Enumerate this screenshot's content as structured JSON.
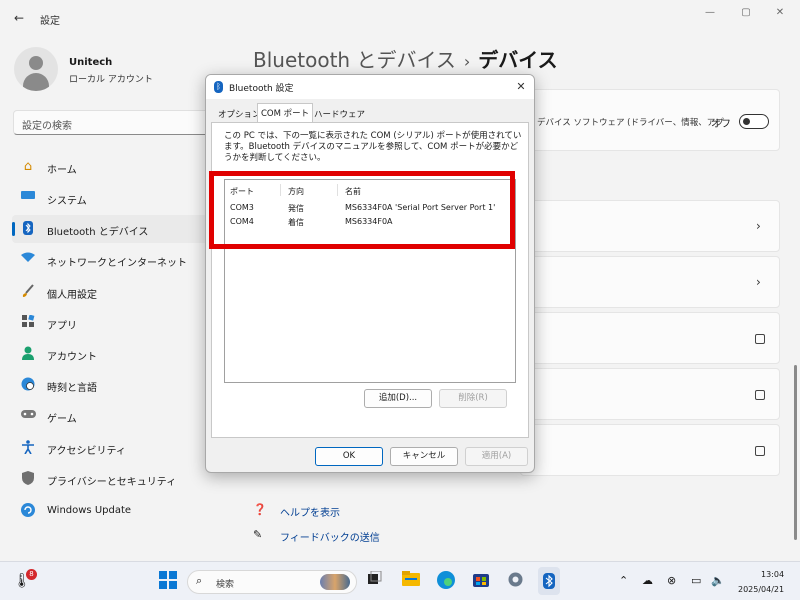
{
  "window": {
    "title": "設定",
    "back": "←",
    "minimize": "—",
    "maximize": "▢",
    "close": "✕"
  },
  "profile": {
    "name": "Unitech",
    "account_type": "ローカル アカウント"
  },
  "search": {
    "placeholder": "設定の検索"
  },
  "sidebar": {
    "items": [
      {
        "label": "ホーム",
        "icon": "home-icon"
      },
      {
        "label": "システム",
        "icon": "monitor-icon"
      },
      {
        "label": "Bluetooth とデバイス",
        "icon": "bluetooth-icon"
      },
      {
        "label": "ネットワークとインターネット",
        "icon": "wifi-icon"
      },
      {
        "label": "個人用設定",
        "icon": "brush-icon"
      },
      {
        "label": "アプリ",
        "icon": "apps-icon"
      },
      {
        "label": "アカウント",
        "icon": "account-icon"
      },
      {
        "label": "時刻と言語",
        "icon": "globe-clock-icon"
      },
      {
        "label": "ゲーム",
        "icon": "gamepad-icon"
      },
      {
        "label": "アクセシビリティ",
        "icon": "accessibility-icon"
      },
      {
        "label": "プライバシーとセキュリティ",
        "icon": "shield-icon"
      },
      {
        "label": "Windows Update",
        "icon": "update-icon"
      }
    ],
    "active_index": 2
  },
  "main": {
    "breadcrumb_parent": "Bluetooth とデバイス",
    "breadcrumb_sep": "›",
    "breadcrumb_current": "デバイス",
    "driver_card_text": "デバイス ソフトウェア (ドライバー、情報、アプ",
    "toggle_label": "オフ",
    "chevron": "›",
    "help_links": [
      {
        "label": "ヘルプを表示",
        "icon": "help-icon"
      },
      {
        "label": "フィードバックの送信",
        "icon": "feedback-icon"
      }
    ]
  },
  "dialog": {
    "title": "Bluetooth 設定",
    "close": "✕",
    "tabs": [
      {
        "label": "オプション"
      },
      {
        "label": "COM ポート"
      },
      {
        "label": "ハードウェア"
      }
    ],
    "active_tab": 1,
    "description": "この PC では、下の一覧に表示された COM (シリアル) ポートが使用されています。Bluetooth デバイスのマニュアルを参照して、COM ポートが必要かどうかを判断してください。",
    "table": {
      "headers": [
        "ポート",
        "方向",
        "名前"
      ],
      "rows": [
        [
          "COM3",
          "発信",
          "MS6334F0A 'Serial Port Server Port 1'"
        ],
        [
          "COM4",
          "着信",
          "MS6334F0A"
        ]
      ]
    },
    "add_button": "追加(D)...",
    "remove_button": "削除(R)",
    "ok_button": "OK",
    "cancel_button": "キャンセル",
    "apply_button": "適用(A)"
  },
  "taskbar": {
    "badge_count": "8",
    "search_placeholder": "検索",
    "time": "13:04",
    "date": "2025/04/21"
  },
  "colors": {
    "accent": "#0067c0",
    "highlight": "#e00000"
  }
}
